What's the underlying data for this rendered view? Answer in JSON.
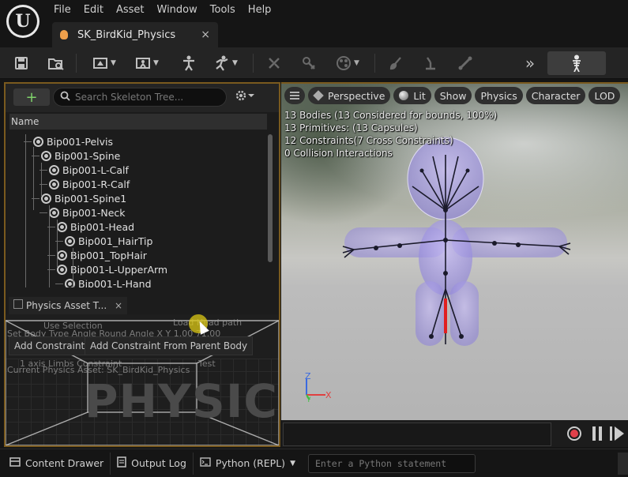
{
  "menu": [
    "File",
    "Edit",
    "Asset",
    "Window",
    "Tools",
    "Help"
  ],
  "document_tab": {
    "label": "SK_BirdKid_Physics",
    "close": "×"
  },
  "toolbar": {
    "save_icon": "save-icon",
    "browse_icon": "find-in-browser-icon",
    "more": "»",
    "character_icon": "skeleton-icon"
  },
  "skeleton_tree": {
    "add_label": "+",
    "search_placeholder": "Search Skeleton Tree...",
    "column_header": "Name",
    "rows": [
      {
        "label": "Bip001-Pelvis",
        "depth": 0
      },
      {
        "label": "Bip001-Spine",
        "depth": 1
      },
      {
        "label": "Bip001-L-Calf",
        "depth": 2
      },
      {
        "label": "Bip001-R-Calf",
        "depth": 2
      },
      {
        "label": "Bip001-Spine1",
        "depth": 1
      },
      {
        "label": "Bip001-Neck",
        "depth": 2
      },
      {
        "label": "Bip001-Head",
        "depth": 3
      },
      {
        "label": "Bip001_HairTip",
        "depth": 4
      },
      {
        "label": "Bip001_TopHair",
        "depth": 3
      },
      {
        "label": "Bip001-L-UpperArm",
        "depth": 3
      },
      {
        "label": "Bip001-L-Hand",
        "depth": 4
      }
    ]
  },
  "physics_tools": {
    "tab_label": "Physics Asset T...",
    "tab_overlay_label": "Physics",
    "close": "×",
    "ghost_rows": [
      "Use Selection",
      "Set Body Type Angle  Round Angle  X  Y  1.00  71.00",
      "Load Head path",
      "1  axis Limbs Constraint",
      "Test",
      "Current Physics Asset: SK_BirdKid_Physics"
    ],
    "add_constraint": "Add Constraint",
    "add_constraint_parent": "Add Constraint From Parent Body",
    "watermark": "PHYSICS"
  },
  "viewport": {
    "menu_icon": "hamburger-icon",
    "perspective": "Perspective",
    "lit": "Lit",
    "show": "Show",
    "physics": "Physics",
    "character": "Character",
    "lod": "LOD",
    "stats": [
      "13 Bodies (13 Considered for bounds, 100%)",
      "13 Primitives: (13 Capsules)",
      "12 Constraints(7 Cross Constraints)",
      "0 Collision Interactions"
    ],
    "axis_z": "Z",
    "axis_x": "X",
    "axis_y": "Y",
    "colors": {
      "body": "#b4a8ee",
      "bone": "#1a1a2a",
      "highlight": "#e02020"
    }
  },
  "statusbar": {
    "content_drawer": "Content Drawer",
    "output_log": "Output Log",
    "python": "Python (REPL)",
    "python_placeholder": "Enter a Python statement"
  }
}
